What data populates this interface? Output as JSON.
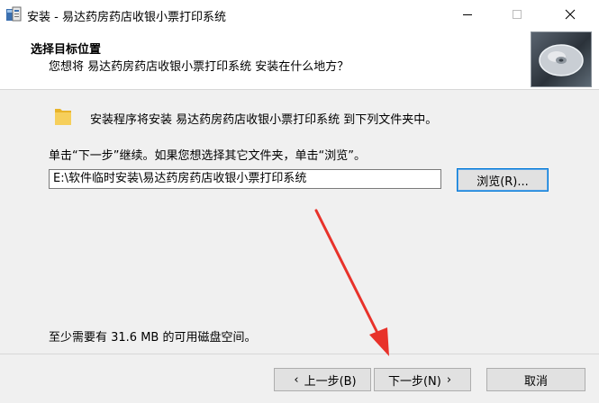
{
  "window": {
    "title": "安装 - 易达药房药店收银小票打印系统"
  },
  "header": {
    "title": "选择目标位置",
    "subtitle": "您想将 易达药房药店收银小票打印系统 安装在什么地方？"
  },
  "body": {
    "install_message": "安装程序将安装 易达药房药店收银小票打印系统 到下列文件夹中。",
    "instruction": "单击“下一步”继续。如果您想选择其它文件夹，单击“浏览”。",
    "path_value": "E:\\软件临时安装\\易达药房药店收银小票打印系统",
    "browse_label": "浏览(R)...",
    "space_required": "至少需要有 31.6 MB 的可用磁盘空间。"
  },
  "footer": {
    "back_label": "上一步(B)",
    "next_label": "下一步(N)",
    "cancel_label": "取消"
  },
  "colors": {
    "annotation_arrow": "#e8322a",
    "focus_border": "#0078d7"
  },
  "icons": [
    "installer-app-icon",
    "minimize-icon",
    "maximize-icon",
    "close-icon",
    "disc-icon",
    "folder-icon",
    "red-arrow-annotation"
  ]
}
